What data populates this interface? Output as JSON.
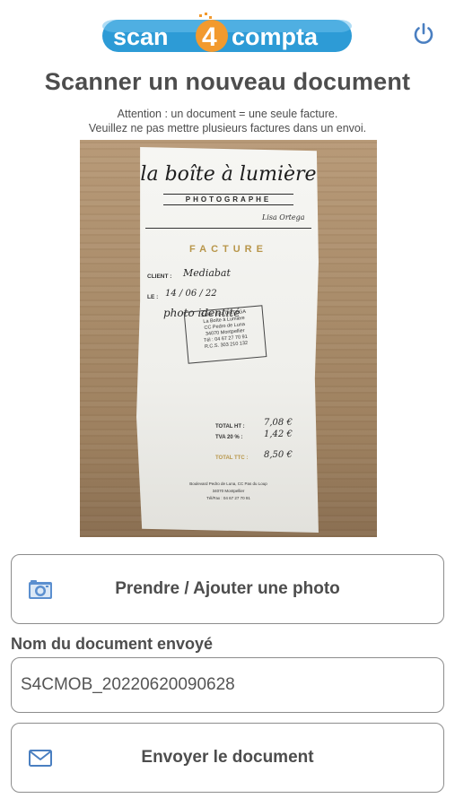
{
  "header": {
    "logo_text": "scan4compta",
    "logo_part1": "scan",
    "logo_digit": "4",
    "logo_part2": "compta",
    "power_icon": "power-icon"
  },
  "page": {
    "title": "Scanner un nouveau document",
    "notice_line1": "Attention : un document = une seule facture.",
    "notice_line2": "Veuillez ne pas mettre plusieurs factures dans un envoi."
  },
  "receipt": {
    "brand": "la boîte à lumière",
    "subtitle": "PHOTOGRAPHE",
    "signature": "Lisa Ortega",
    "heading": "FACTURE",
    "client_label": "CLIENT :",
    "client_value": "Mediabat",
    "date_label": "LE :",
    "date_value": "14 / 06 / 22",
    "item": "photo identité",
    "stamp_line1": "SARL Lisa ORTEGA",
    "stamp_line2": "La Boîte à Lumière",
    "stamp_line3": "CC Pedro de Luna",
    "stamp_line4": "34070 Montpellier",
    "stamp_line5": "Tél : 04 67 27 70 91",
    "stamp_line6": "R.C.S. 303 210 132",
    "total_ht_label": "TOTAL HT :",
    "total_ht_value": "7,08 €",
    "tva_label": "TVA 20 % :",
    "tva_value": "1,42 €",
    "total_ttc_label": "TOTAL TTC :",
    "total_ttc_value": "8,50 €",
    "footer_line1": "Boulevard Pedro de Luna, CC Pas du Loup",
    "footer_line2": "34070 Montpellier",
    "footer_line3": "Tél/Fax : 04 67 27 70 91"
  },
  "actions": {
    "photo_button": "Prendre / Ajouter une photo",
    "photo_icon": "camera-icon",
    "send_button": "Envoyer le document",
    "send_icon": "envelope-icon"
  },
  "document_name": {
    "label": "Nom du document envoyé",
    "value": "S4CMOB_20220620090628"
  },
  "colors": {
    "logo_blue": "#2d9bd6",
    "logo_orange": "#f29a2e",
    "text": "#4d4d4d",
    "border": "#8c8c8c",
    "icon_blue": "#4a7fc1"
  }
}
